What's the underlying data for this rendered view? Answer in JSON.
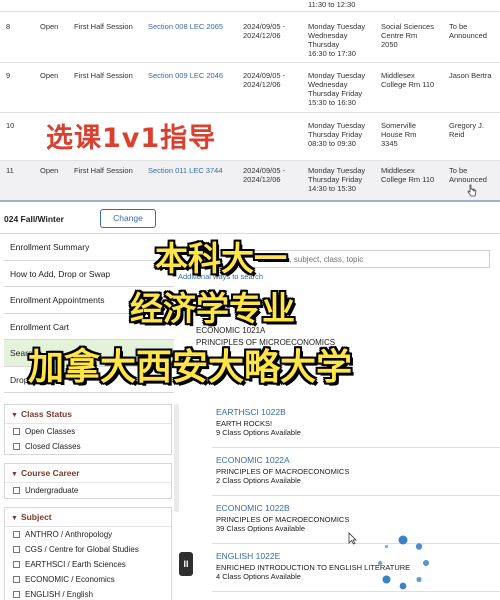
{
  "sections": [
    {
      "no": "",
      "status": "",
      "session": "",
      "section": "",
      "dates": [
        "",
        ""
      ],
      "days": [
        "11:30 to 12:30"
      ],
      "location": [],
      "instructor": []
    },
    {
      "no": "8",
      "status": "Open",
      "session": "First Half Session",
      "section": "Section 008 LEC 2065",
      "dates": [
        "2024/09/05 -",
        "2024/12/06"
      ],
      "days": [
        "Monday Tuesday",
        "Wednesday",
        "Thursday",
        "16:30 to 17:30"
      ],
      "location": [
        "Social Sciences",
        "Centre Rm",
        "2050"
      ],
      "instructor": [
        "To be",
        "Announced"
      ]
    },
    {
      "no": "9",
      "status": "Open",
      "session": "First Half Session",
      "section": "Section 009 LEC 2046",
      "dates": [
        "2024/09/05 -",
        "2024/12/06"
      ],
      "days": [
        "Monday Tuesday",
        "Wednesday",
        "Thursday Friday",
        "15:30 to 16:30"
      ],
      "location": [
        "Middlesex",
        "College Rm 110"
      ],
      "instructor": [
        "Jason Bertra"
      ]
    },
    {
      "no": "10",
      "status": "",
      "session": "",
      "section": "",
      "dates": [
        "",
        ""
      ],
      "days": [
        "Monday Tuesday",
        "Thursday Friday",
        "08:30 to 09:30"
      ],
      "location": [
        "Somerville",
        "House Rm",
        "3345"
      ],
      "instructor": [
        "Gregory J.",
        "Reid"
      ]
    },
    {
      "no": "11",
      "status": "Open",
      "session": "First Half Session",
      "section": "Section 011 LEC 3744",
      "dates": [
        "2024/09/05 -",
        "2024/12/06"
      ],
      "days": [
        "Monday Tuesday",
        "Thursday Friday",
        "14:30 to 15:30"
      ],
      "location": [
        "Middlesex",
        "College Rm 110"
      ],
      "instructor": [
        "To be",
        "Announced"
      ]
    }
  ],
  "term": {
    "label": "024 Fall/Winter",
    "change_label": "Change"
  },
  "nav": {
    "items": [
      {
        "label": "Enrollment Summary"
      },
      {
        "label": "How to Add, Drop or Swap"
      },
      {
        "label": "Enrollment Appointments"
      },
      {
        "label": "Enrollment Cart"
      },
      {
        "label": "Searc"
      },
      {
        "label": "Drop"
      }
    ]
  },
  "search": {
    "placeholder": "se, subject, class, topic",
    "advanced_link": "Additional ways to search"
  },
  "econ_result": {
    "code": "ECONOMIC 1021A",
    "title": "PRINCIPLES OF MICROECONOMICS"
  },
  "filters": [
    {
      "heading": "Class Status",
      "options": [
        "Open Classes",
        "Closed Classes"
      ]
    },
    {
      "heading": "Course Career",
      "options": [
        "Undergraduate"
      ]
    },
    {
      "heading": "Subject",
      "options": [
        "ANTHRO / Anthropology",
        "CGS / Centre for Global Studies",
        "EARTHSCI / Earth Sciences",
        "ECONOMIC / Economics",
        "ENGLISH / English"
      ]
    }
  ],
  "results": [
    {
      "code": "EARTHSCI 1022B",
      "name": "EARTH ROCKS!",
      "options": "9 Class Options Available"
    },
    {
      "code": "ECONOMIC 1022A",
      "name": "PRINCIPLES OF MACROECONOMICS",
      "options": "2 Class Options Available"
    },
    {
      "code": "ECONOMIC 1022B",
      "name": "PRINCIPLES OF MACROECONOMICS",
      "options": "39 Class Options Available"
    },
    {
      "code": "ENGLISH 1022E",
      "name": "ENRICHED INTRODUCTION TO ENGLISH LITERATURE",
      "options": "4 Class Options Available"
    }
  ],
  "handle_label": "II",
  "captions": {
    "red": "选课1v1指导",
    "line1": "本科大一",
    "line2": "经济学专业",
    "line3": "加拿大西安大略大学"
  },
  "colors": {
    "link": "#3a6aa8",
    "filter_heading": "#7a3a2a",
    "caption_red": "#d94030",
    "caption_yellow": "#ffe44a",
    "active_nav": "#e4f2da",
    "spinner": "#3b82c4"
  },
  "icons": [
    "caret-down-icon",
    "checkbox-icon",
    "search-icon",
    "loading-spinner-icon",
    "cursor-icon",
    "pointer-icon",
    "collapse-handle-icon"
  ]
}
